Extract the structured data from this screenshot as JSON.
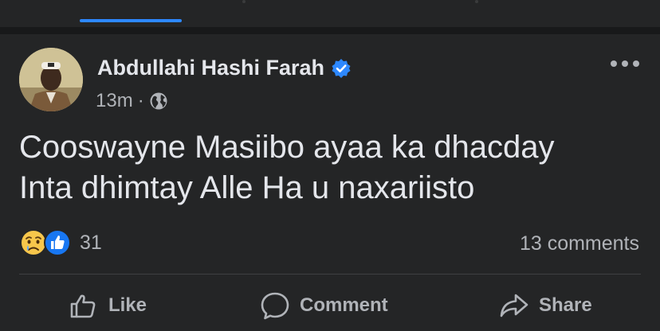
{
  "post": {
    "author": "Abdullahi Hashi Farah",
    "time": "13m",
    "separator": "·",
    "text": "Cooswayne Masiibo ayaa ka dhacday\nInta dhimtay Alle Ha u naxariisto",
    "reactions_count": "31",
    "comments_label": "13 comments"
  },
  "actions": {
    "like": "Like",
    "comment": "Comment",
    "share": "Share"
  },
  "icons": {
    "verified": "verified-badge-icon",
    "audience": "globe-icon",
    "more": "more-options-icon",
    "reaction_1": "sad-reaction-icon",
    "reaction_2": "like-reaction-icon"
  },
  "colors": {
    "background": "#242526",
    "accent": "#2d88ff",
    "text": "#e4e6eb",
    "muted": "#b0b3b8"
  }
}
